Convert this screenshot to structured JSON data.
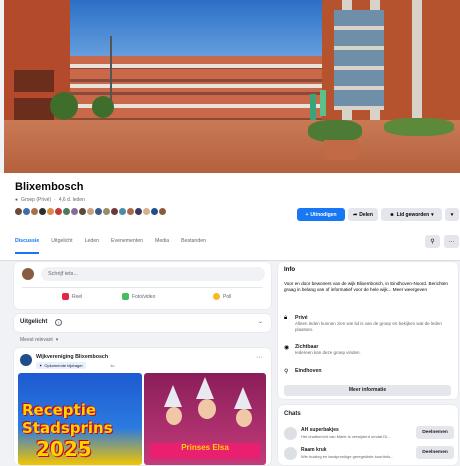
{
  "group": {
    "name": "Blixembosch",
    "type": "Groep (Privé)",
    "members": "4,6 d. leden"
  },
  "actions": {
    "invite": "Uitnodigen",
    "share": "Delen",
    "member": "Lid geworden"
  },
  "tabs": [
    "Discussie",
    "Uitgelicht",
    "Leden",
    "Evenementen",
    "Media",
    "Bestanden"
  ],
  "composer": {
    "placeholder": "Schrijf iets...",
    "reel": "Reel",
    "photo": "Foto/video",
    "poll": "Poll"
  },
  "featured": {
    "label": "Uitgelicht"
  },
  "sort": {
    "label": "Meest relevant"
  },
  "post": {
    "author": "Wijkvereniging Blixembosch",
    "badge": "Opkomende bijdrager",
    "time": "1u",
    "image1_lines": [
      "Receptie",
      "Stadsprins",
      "2025"
    ],
    "image2_banner": "Prinses Elsa"
  },
  "info": {
    "title": "Info",
    "description": "Voor en door bewoners van de wijk Blixembosch, in Eindhoven-Noord. Berichten graag in belang van of informatief voor de hele wijk... Meer weergeven",
    "private_title": "Privé",
    "private_desc": "Alleen leden kunnen zien wie lid is van de groep en bekijken wat de leden plaatsen.",
    "visible_title": "Zichtbaar",
    "visible_desc": "Iedereen kan deze groep vinden.",
    "location": "Eindhoven",
    "more_button": "Meer informatie"
  },
  "chats": {
    "title": "Chats",
    "items": [
      {
        "name": "AH superbakjes",
        "desc": "Het chatbericht van Marle is verwijderd omdat Di...",
        "join": "Deelnemen"
      },
      {
        "name": "Raam kruk",
        "desc": "Wie huisleg en tandpronkige geregeldste buurtinfo...",
        "join": "Deelnemen"
      }
    ]
  },
  "colors": {
    "accent": "#1877f2",
    "surface": "#ffffff",
    "background": "#f0f2f5"
  }
}
